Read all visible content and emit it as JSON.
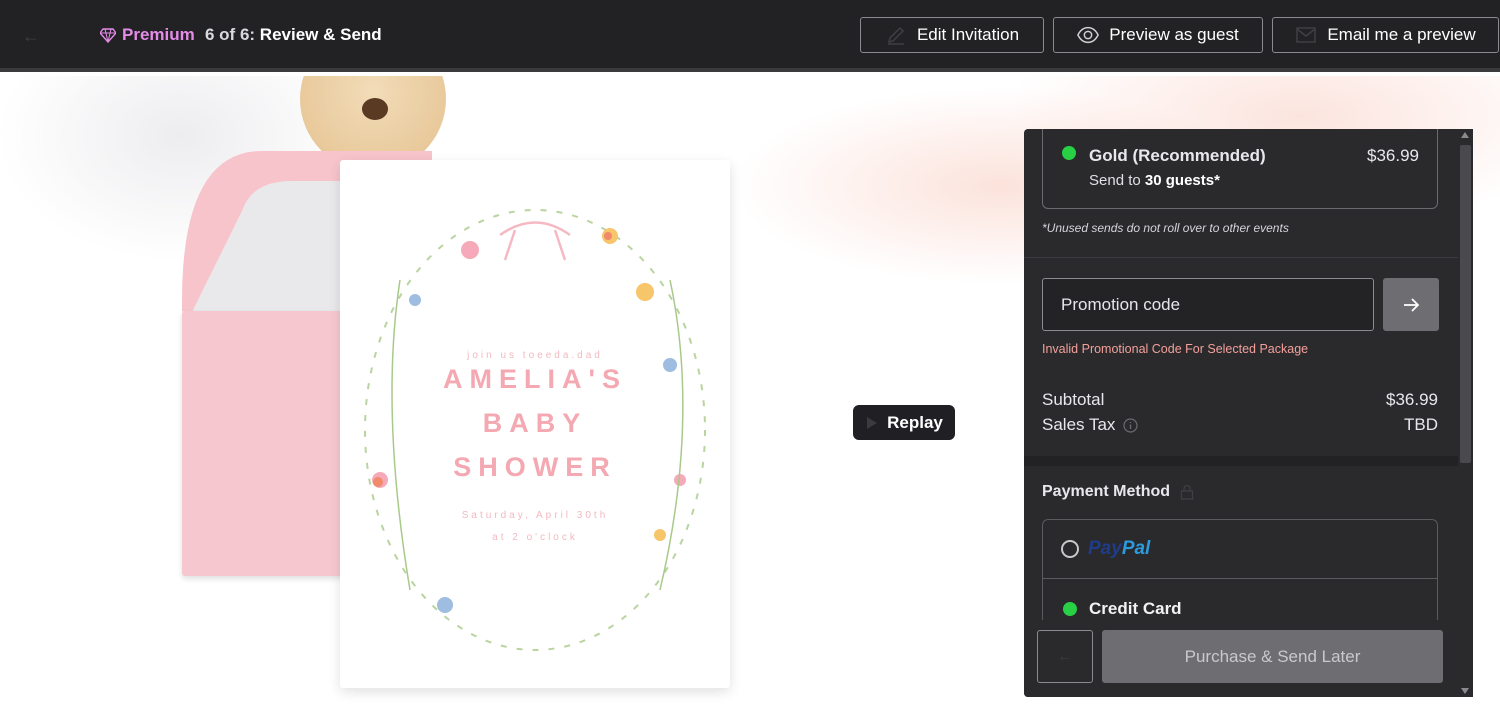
{
  "topbar": {
    "premium_label": "Premium",
    "step_prefix": "6 of 6:",
    "step_name": "Review & Send",
    "edit_label": "Edit Invitation",
    "preview_label": "Preview as guest",
    "email_label": "Email me a preview"
  },
  "invitation": {
    "line1": "join us toeeda.dad",
    "name": "AMELIA'S",
    "line2": "BABY",
    "line3": "SHOWER",
    "date": "Saturday, April 30th",
    "time": "at 2 o'clock"
  },
  "replay_label": "Replay",
  "panel": {
    "package": {
      "name": "Gold (Recommended)",
      "price": "$36.99",
      "send_prefix": "Send to",
      "guests": "30 guests*"
    },
    "note": "*Unused sends do not roll over to other events",
    "promo": {
      "placeholder": "Promotion code",
      "error": "Invalid Promotional Code For Selected Package"
    },
    "subtotal_label": "Subtotal",
    "subtotal_value": "$36.99",
    "tax_label": "Sales Tax",
    "tax_value": "TBD",
    "payment_title": "Payment Method",
    "paypal_part1": "Pay",
    "paypal_part2": "Pal",
    "credit_card_label": "Credit Card",
    "purchase_label": "Purchase & Send Later"
  },
  "colors": {
    "accent_premium": "#e58be8",
    "selected_green": "#27d045",
    "error_text": "#f3a09a",
    "panel_bg": "#2a2a2d",
    "topbar_bg": "#222225"
  }
}
